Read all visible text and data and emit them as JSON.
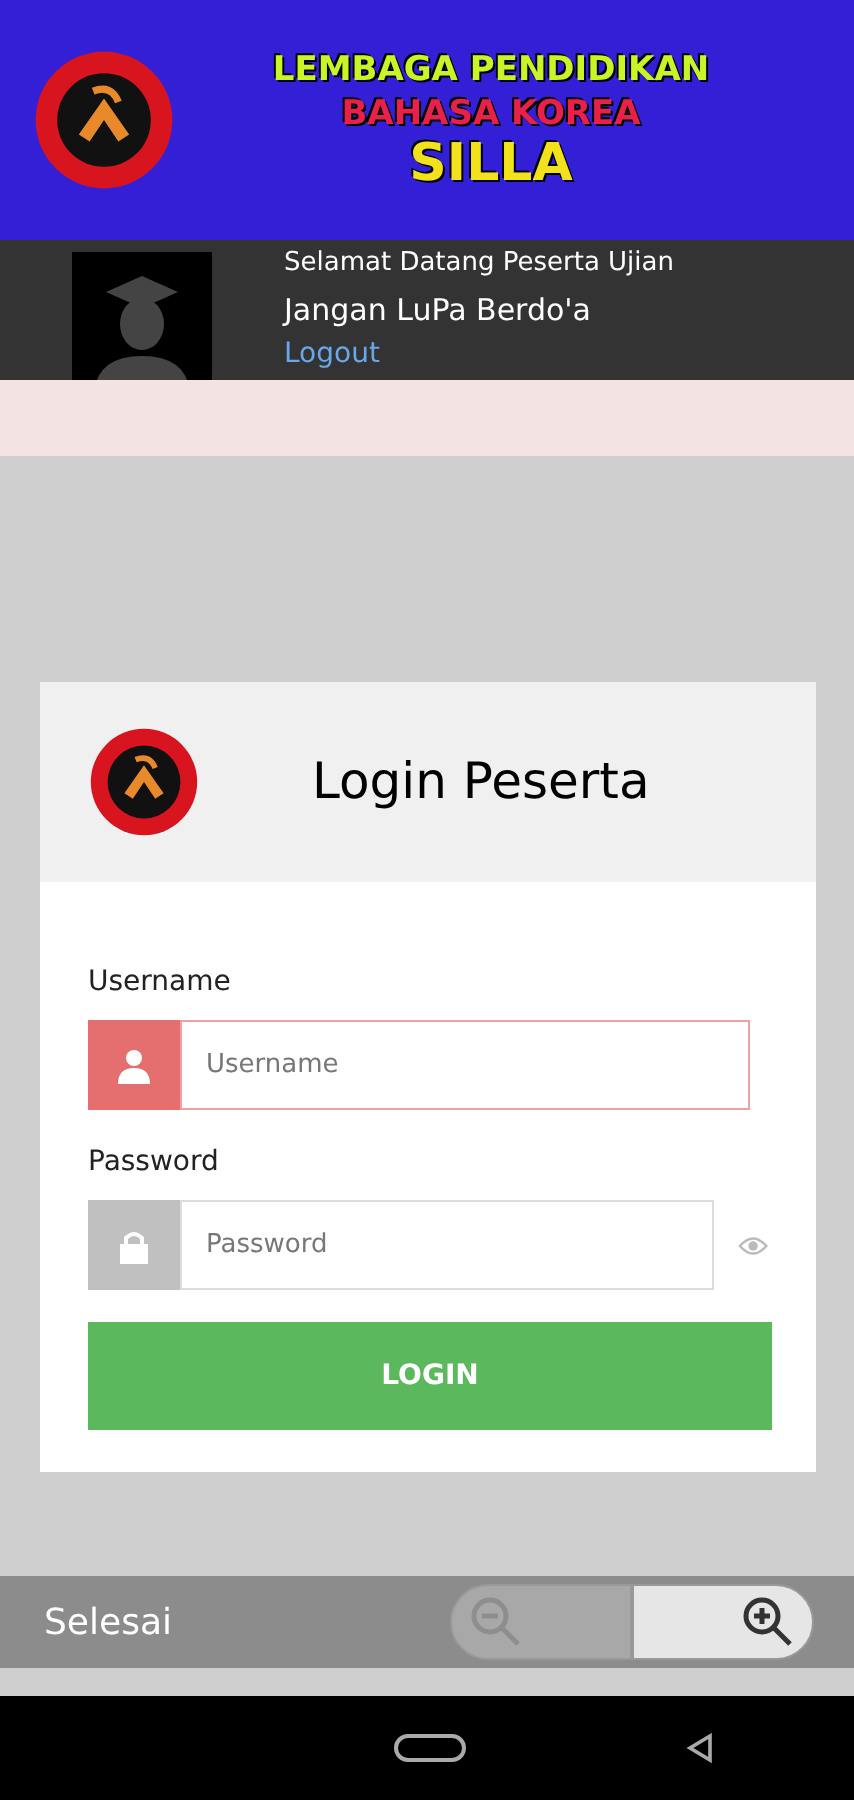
{
  "banner": {
    "lines": [
      {
        "text": "LEMBAGA PENDIDIKAN",
        "color": "#c8f526"
      },
      {
        "text": "BAHASA KOREA",
        "color": "#e8204a"
      },
      {
        "text": "SILLA",
        "color": "#f2e21c"
      }
    ]
  },
  "user_bar": {
    "greeting": "Selamat Datang Peserta Ujian",
    "message": "Jangan LuPa Berdo'a",
    "logout": "Logout"
  },
  "login_card": {
    "title": "Login Peserta",
    "fields": [
      {
        "label": "Username",
        "placeholder": "Username",
        "kind": "user",
        "focused": true
      },
      {
        "label": "Password",
        "placeholder": "Password",
        "kind": "password",
        "focused": false
      }
    ],
    "button": "LOGIN"
  },
  "bottom_bar": {
    "done": "Selesai",
    "zoom_out": {
      "disabled": true
    },
    "zoom_in": {
      "disabled": false
    }
  }
}
